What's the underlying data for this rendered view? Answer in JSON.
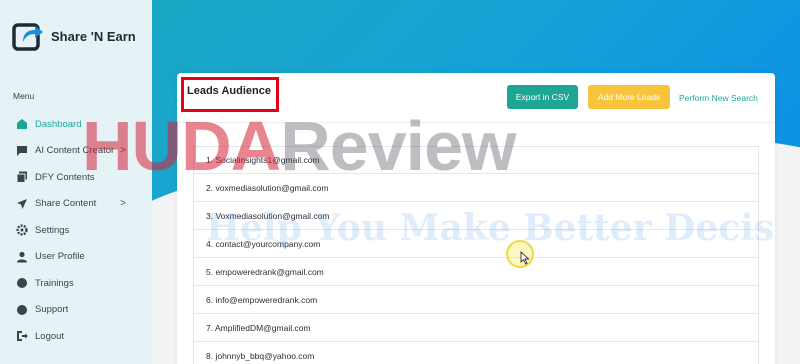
{
  "brand": {
    "name": "Share 'N Earn"
  },
  "sidebar": {
    "menu_heading": "Menu",
    "items": [
      {
        "label": "Dashboard",
        "icon": "home-icon",
        "active": true
      },
      {
        "label": "AI Content Creator",
        "icon": "chat-icon",
        "chevron": ">"
      },
      {
        "label": "DFY Contents",
        "icon": "copy-icon"
      },
      {
        "label": "Share Content",
        "icon": "send-icon",
        "chevron": ">"
      },
      {
        "label": "Settings",
        "icon": "gear-icon"
      },
      {
        "label": "User Profile",
        "icon": "user-icon"
      },
      {
        "label": "Trainings",
        "icon": "book-icon"
      },
      {
        "label": "Support",
        "icon": "support-icon"
      },
      {
        "label": "Logout",
        "icon": "logout-icon"
      }
    ]
  },
  "card": {
    "title": "Leads Audience",
    "export_label": "Export in CSV",
    "add_label": "Add More Leads",
    "search_label": "Perform New Search"
  },
  "leads": [
    "1. Socialinsights1@gmail.com",
    "2. voxmediasolution@gmail.com",
    "3. Voxmediasolution@gmail.com",
    "4. contact@yourcompany.com",
    "5. empoweredrank@gmail.com",
    "6. info@empoweredrank.com",
    "7. AmplifiedDM@gmail.com",
    "8. johnnyb_bbq@yahoo.com"
  ],
  "watermark": {
    "part1": "HUDA",
    "part2": "Review",
    "tagline": "Help You Make Better Decis"
  },
  "colors": {
    "accent": "#1aa79a",
    "export": "#1fa593",
    "add": "#f7c43c",
    "highlight": "#e3001b"
  }
}
